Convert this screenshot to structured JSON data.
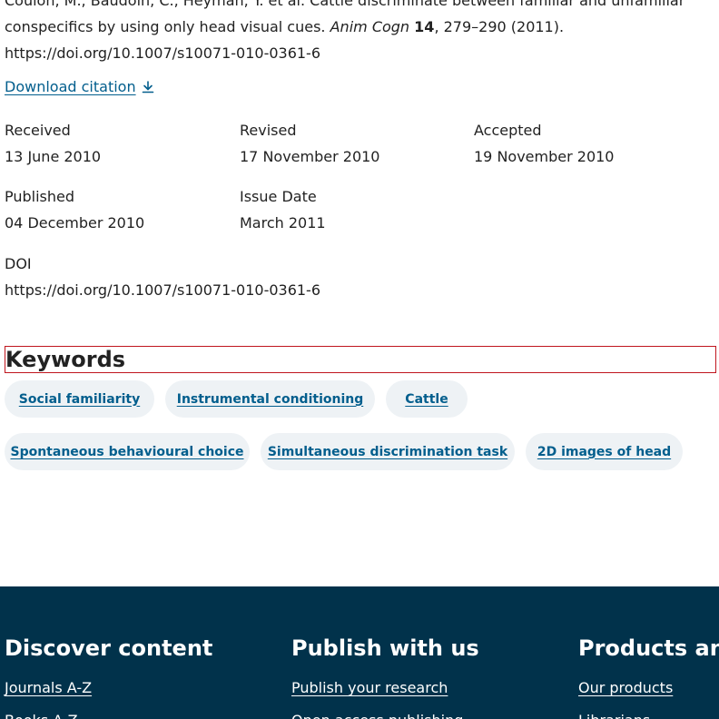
{
  "citation": {
    "line1": "Coulon, M., Baudoin, C., Heyman, Y. et al. Cattle discriminate between familiar and unfamiliar",
    "line2_pre": "conspecifics by using only head visual cues.",
    "journal": "Anim Cogn",
    "volume": "14",
    "pages_year": ", 279–290 (2011).",
    "doi_url": "https://doi.org/10.1007/s10071-010-0361-6"
  },
  "download_citation": "Download citation",
  "dates": {
    "received_label": "Received",
    "received_value": "13 June 2010",
    "revised_label": "Revised",
    "revised_value": "17 November 2010",
    "accepted_label": "Accepted",
    "accepted_value": "19 November 2010",
    "published_label": "Published",
    "published_value": "04 December 2010",
    "issue_label": "Issue Date",
    "issue_value": "March 2011",
    "doi_label": "DOI",
    "doi_value": "https://doi.org/10.1007/s10071-010-0361-6"
  },
  "keywords": {
    "heading": "Keywords",
    "items": [
      "Social familiarity",
      "Instrumental conditioning",
      "Cattle",
      "Spontaneous behavioural choice",
      "Simultaneous discrimination task",
      "2D images of head"
    ]
  },
  "footer": {
    "col1_title": "Discover content",
    "col1_links": [
      "Journals A-Z",
      "Books A-Z"
    ],
    "col2_title": "Publish with us",
    "col2_links": [
      "Publish your research",
      "Open access publishing"
    ],
    "col3_title": "Products and",
    "col3_links": [
      "Our products",
      "Librarians"
    ]
  },
  "colors": {
    "link": "#025e8d",
    "footer_bg": "#01324b",
    "pill_bg": "#eef2f5",
    "highlight_border": "#c0161e"
  }
}
